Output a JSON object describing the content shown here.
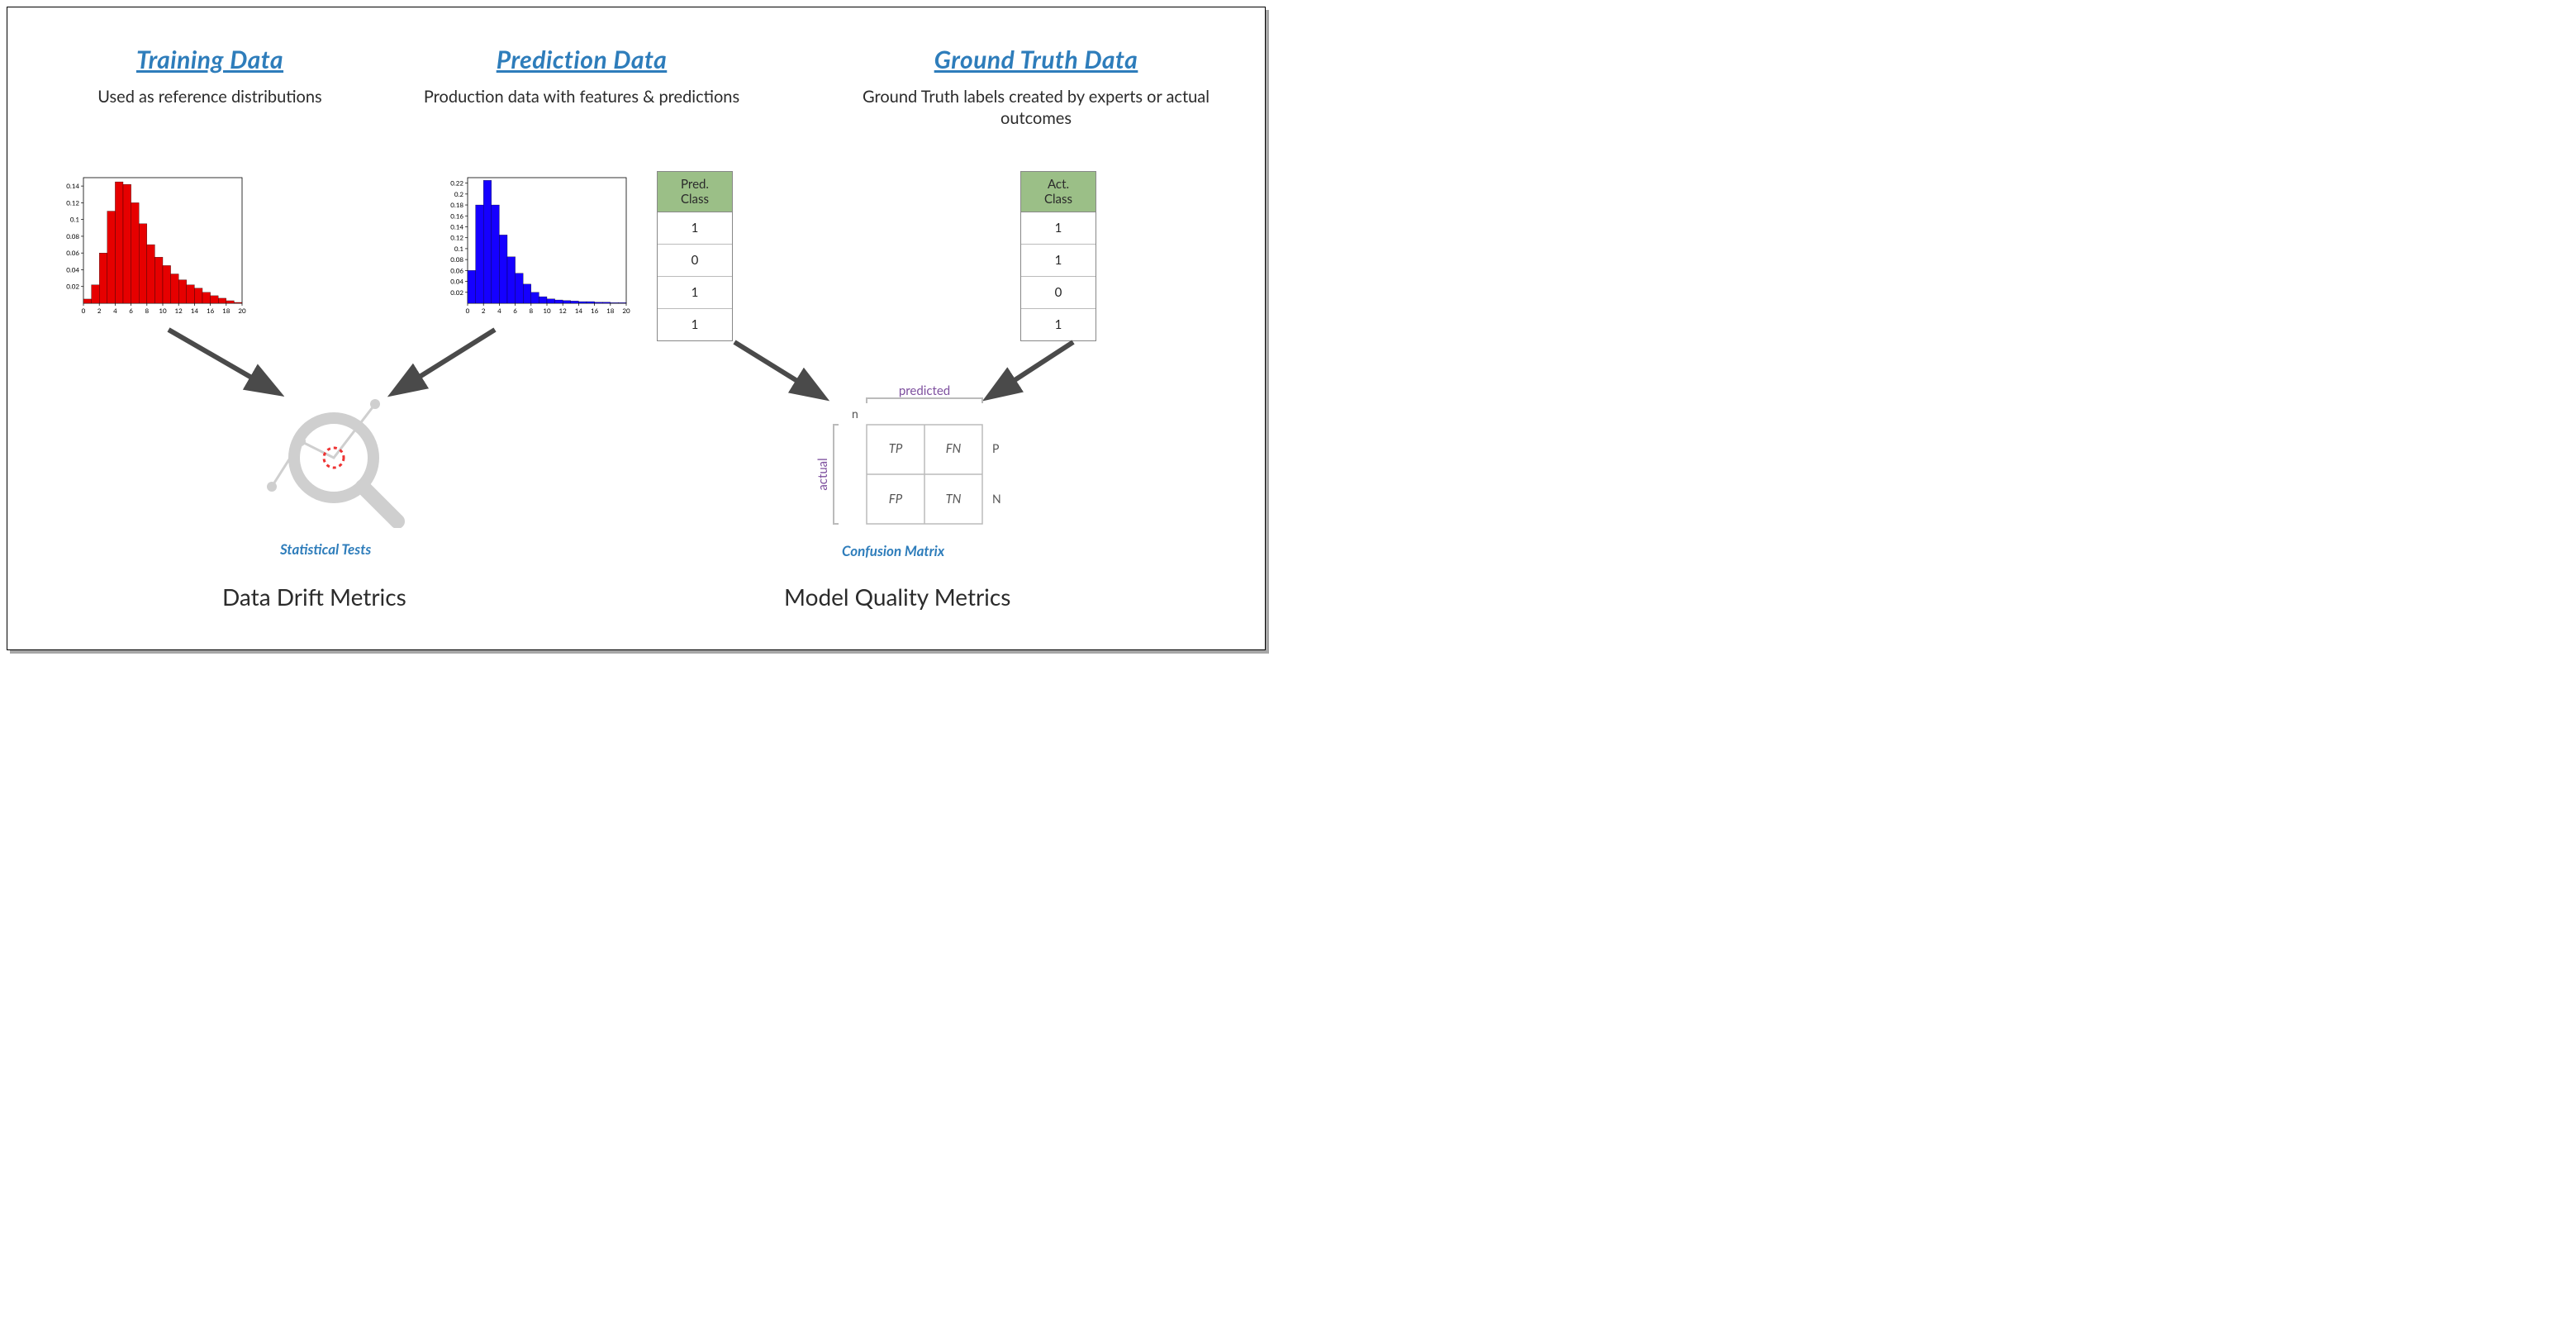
{
  "columns": {
    "training": {
      "title": "Training Data",
      "sub": "Used as reference distributions"
    },
    "prediction": {
      "title": "Prediction Data",
      "sub": "Production data with features & predictions"
    },
    "truth": {
      "title": "Ground Truth Data",
      "sub": "Ground Truth labels created by experts or actual outcomes"
    }
  },
  "pred_table": {
    "header": "Pred.\nClass",
    "rows": [
      "1",
      "0",
      "1",
      "1"
    ]
  },
  "act_table": {
    "header": "Act.\nClass",
    "rows": [
      "1",
      "1",
      "0",
      "1"
    ]
  },
  "confusion": {
    "top_label": "predicted",
    "left_label": "actual",
    "n": "n",
    "tp": "TP",
    "fn": "FN",
    "fp": "FP",
    "tn": "TN",
    "p": "P",
    "nn": "N"
  },
  "stat_tests_label": "Statistical Tests",
  "confusion_label": "Confusion Matrix",
  "drift_label": "Data Drift Metrics",
  "quality_label": "Model Quality Metrics",
  "chart_data": [
    {
      "type": "bar",
      "id": "training_histogram",
      "title": "",
      "xlabel": "",
      "ylabel": "",
      "xlim": [
        0,
        20
      ],
      "ylim": [
        0,
        0.15
      ],
      "xticks": [
        0,
        2,
        4,
        6,
        8,
        10,
        12,
        14,
        16,
        18,
        20
      ],
      "yticks": [
        0.02,
        0.04,
        0.06,
        0.08,
        0.1,
        0.12,
        0.14
      ],
      "categories": [
        0.5,
        1.5,
        2.5,
        3.5,
        4.5,
        5.5,
        6.5,
        7.5,
        8.5,
        9.5,
        10.5,
        11.5,
        12.5,
        13.5,
        14.5,
        15.5,
        16.5,
        17.5,
        18.5,
        19.5
      ],
      "values": [
        0.005,
        0.022,
        0.06,
        0.11,
        0.145,
        0.142,
        0.12,
        0.095,
        0.07,
        0.055,
        0.045,
        0.035,
        0.028,
        0.022,
        0.018,
        0.013,
        0.009,
        0.006,
        0.003,
        0.001
      ],
      "color": "#e60000"
    },
    {
      "type": "bar",
      "id": "prediction_histogram",
      "title": "",
      "xlabel": "",
      "ylabel": "",
      "xlim": [
        0,
        20
      ],
      "ylim": [
        0,
        0.23
      ],
      "xticks": [
        0,
        2,
        4,
        6,
        8,
        10,
        12,
        14,
        16,
        18,
        20
      ],
      "yticks": [
        0.02,
        0.04,
        0.06,
        0.08,
        0.1,
        0.12,
        0.14,
        0.16,
        0.18,
        0.2,
        0.22
      ],
      "categories": [
        0.5,
        1.5,
        2.5,
        3.5,
        4.5,
        5.5,
        6.5,
        7.5,
        8.5,
        9.5,
        10.5,
        11.5,
        12.5,
        13.5,
        14.5,
        15.5,
        16.5,
        17.5,
        18.5,
        19.5
      ],
      "values": [
        0.06,
        0.18,
        0.225,
        0.18,
        0.125,
        0.085,
        0.055,
        0.035,
        0.02,
        0.012,
        0.008,
        0.006,
        0.005,
        0.004,
        0.003,
        0.003,
        0.002,
        0.002,
        0.001,
        0.001
      ],
      "color": "#1500ff"
    }
  ]
}
